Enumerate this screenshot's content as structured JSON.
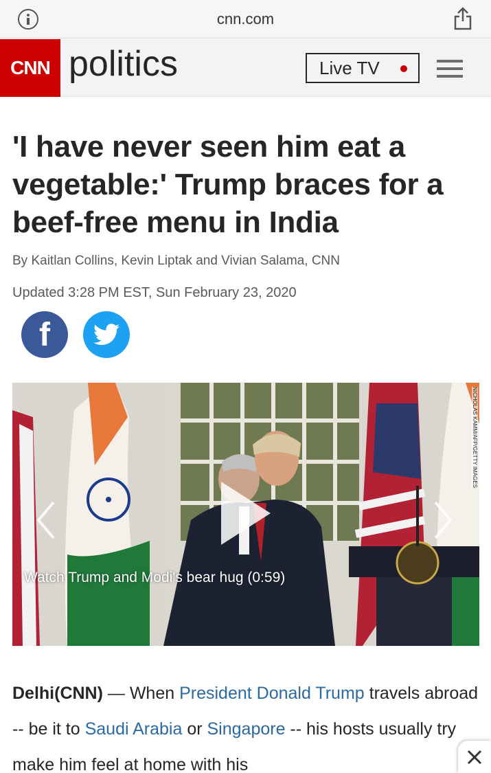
{
  "browser": {
    "url": "cnn.com",
    "info_icon": "info-icon",
    "share_icon": "share-icon"
  },
  "header": {
    "logo": "CNN",
    "section": "politics",
    "live_tv": "Live TV",
    "menu_icon": "hamburger-menu-icon",
    "accent": "#cc0000"
  },
  "article": {
    "headline": "'I have never seen him eat a vegetable:' Trump braces for a beef-free menu in India",
    "byline": "By Kaitlan Collins, Kevin Liptak and Vivian Salama, CNN",
    "updated": "Updated 3:28 PM EST, Sun February 23, 2020",
    "share": {
      "facebook": "facebook-icon",
      "twitter": "twitter-icon"
    },
    "video": {
      "caption": "Watch Trump and Modi's bear hug (0:59)",
      "credit": "NICHOLAS KAMM/AFP/GETTY IMAGES"
    },
    "body": {
      "dateline": "Delhi(CNN)",
      "dash": " — When ",
      "link1": "President Donald Trump",
      "text1": " travels abroad -- be it to ",
      "link2": "Saudi Arabia",
      "text2": " or ",
      "link3": "Singapore",
      "text3": " -- his hosts usually try make him feel at home with his"
    }
  },
  "close_icon": "close-icon"
}
